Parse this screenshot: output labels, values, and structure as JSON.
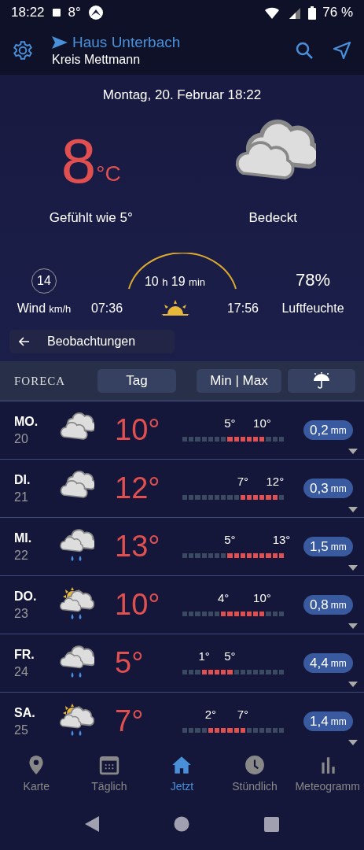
{
  "status_bar": {
    "time": "18:22",
    "temperature": "8°",
    "battery": "76 %"
  },
  "header": {
    "location": "Haus Unterbach",
    "region": "Kreis Mettmann"
  },
  "date": "Montag, 20. Februar 18:22",
  "current": {
    "temperature": "8",
    "unit": "°C",
    "feels_like": "Gefühlt wie 5°",
    "condition": "Bedeckt"
  },
  "details": {
    "wind_speed": "14",
    "wind_label": "Wind",
    "wind_unit": "km/h",
    "daylight_hours": "10",
    "hours_unit": "h",
    "daylight_minutes": "19",
    "minutes_unit": "min",
    "sunrise": "07:36",
    "sunset": "17:56",
    "humidity": "78%",
    "humidity_label": "Luftfeuchte"
  },
  "observations_button": "Beobachtungen",
  "toolbar": {
    "brand": "FORECA",
    "day_button": "Tag",
    "minmax_button": "Min | Max"
  },
  "days": [
    {
      "day": "MO.",
      "date": "20",
      "kind": "cloudy",
      "temperature": "10°",
      "min": "5°",
      "max": "10°",
      "precipitation": "0,2",
      "unit": "mm"
    },
    {
      "day": "DI.",
      "date": "21",
      "kind": "cloudy",
      "temperature": "12°",
      "min": "7°",
      "max": "12°",
      "precipitation": "0,3",
      "unit": "mm"
    },
    {
      "day": "MI.",
      "date": "22",
      "kind": "rain",
      "temperature": "13°",
      "min": "5°",
      "max": "13°",
      "precipitation": "1,5",
      "unit": "mm"
    },
    {
      "day": "DO.",
      "date": "23",
      "kind": "sun-rain",
      "temperature": "10°",
      "min": "4°",
      "max": "10°",
      "precipitation": "0,8",
      "unit": "mm"
    },
    {
      "day": "FR.",
      "date": "24",
      "kind": "rain",
      "temperature": "5°",
      "min": "1°",
      "max": "5°",
      "precipitation": "4,4",
      "unit": "mm"
    },
    {
      "day": "SA.",
      "date": "25",
      "kind": "sun-rain",
      "temperature": "7°",
      "min": "2°",
      "max": "7°",
      "precipitation": "1,4",
      "unit": "mm"
    }
  ],
  "nav": [
    {
      "kind": "map",
      "label": "Karte",
      "selected": false
    },
    {
      "kind": "calendar",
      "label": "Täglich",
      "selected": false
    },
    {
      "kind": "home",
      "label": "Jetzt",
      "selected": true
    },
    {
      "kind": "clock",
      "label": "Stündlich",
      "selected": false
    },
    {
      "kind": "chart",
      "label": "Meteogramm",
      "selected": false
    }
  ]
}
